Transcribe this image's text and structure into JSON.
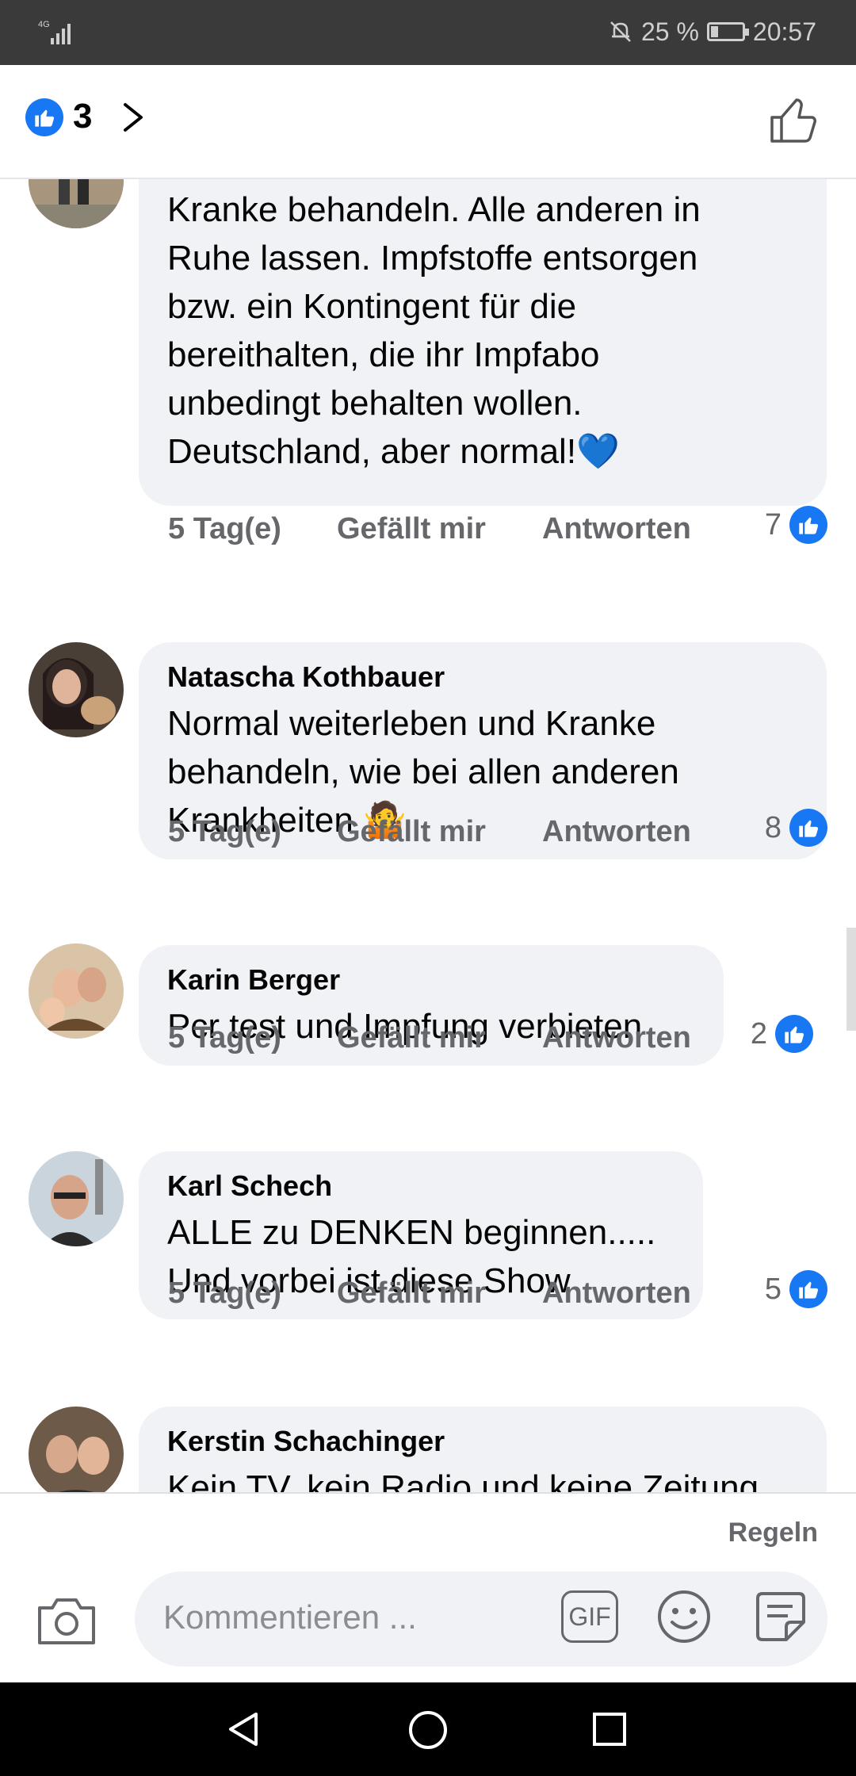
{
  "status_bar": {
    "network": "4G",
    "battery": "25 %",
    "battery_level": 0.25,
    "time": "20:57"
  },
  "header": {
    "like_count": "3"
  },
  "comments": [
    {
      "name": "",
      "text": "Kranke behandeln. Alle anderen in\nRuhe lassen. Impfstoffe entsorgen\nbzw. ein Kontingent für die\nbereithalten, die ihr Impfabo\nunbedingt behalten wollen.\nDeutschland, aber normal!💙",
      "time": "5 Tag(e)",
      "like_label": "Gefällt mir",
      "reply_label": "Antworten",
      "reactions": "7"
    },
    {
      "name": "Natascha Kothbauer",
      "text": "Normal weiterleben und Kranke\nbehandeln, wie bei allen anderen\nKrankheiten 🤷",
      "time": "5 Tag(e)",
      "like_label": "Gefällt mir",
      "reply_label": "Antworten",
      "reactions": "8"
    },
    {
      "name": "Karin Berger",
      "text": "Pcr test und Impfung verbieten",
      "time": "5 Tag(e)",
      "like_label": "Gefällt mir",
      "reply_label": "Antworten",
      "reactions": "2"
    },
    {
      "name": "Karl Schech",
      "text": "ALLE zu DENKEN beginnen.....\nUnd vorbei ist diese Show",
      "time": "5 Tag(e)",
      "like_label": "Gefällt mir",
      "reply_label": "Antworten",
      "reactions": "5"
    },
    {
      "name": "Kerstin Schachinger",
      "text": "Kein TV, kein Radio und keine Zeitung\n😌"
    }
  ],
  "composer": {
    "rules_label": "Regeln",
    "placeholder": "Kommentieren ...",
    "gif_label": "GIF"
  },
  "icons": {
    "like": "like-badge-icon",
    "chevron": "chevron-right-icon",
    "thumb": "thumbs-up-outline-icon",
    "camera": "camera-icon",
    "emoji": "smiley-icon",
    "sticker": "sticker-icon",
    "nav_back": "back-triangle-icon",
    "nav_home": "home-circle-icon",
    "nav_recent": "recent-square-icon"
  },
  "colors": {
    "accent": "#1877f2",
    "bubble": "#f0f2f5",
    "muted": "#65676b"
  }
}
